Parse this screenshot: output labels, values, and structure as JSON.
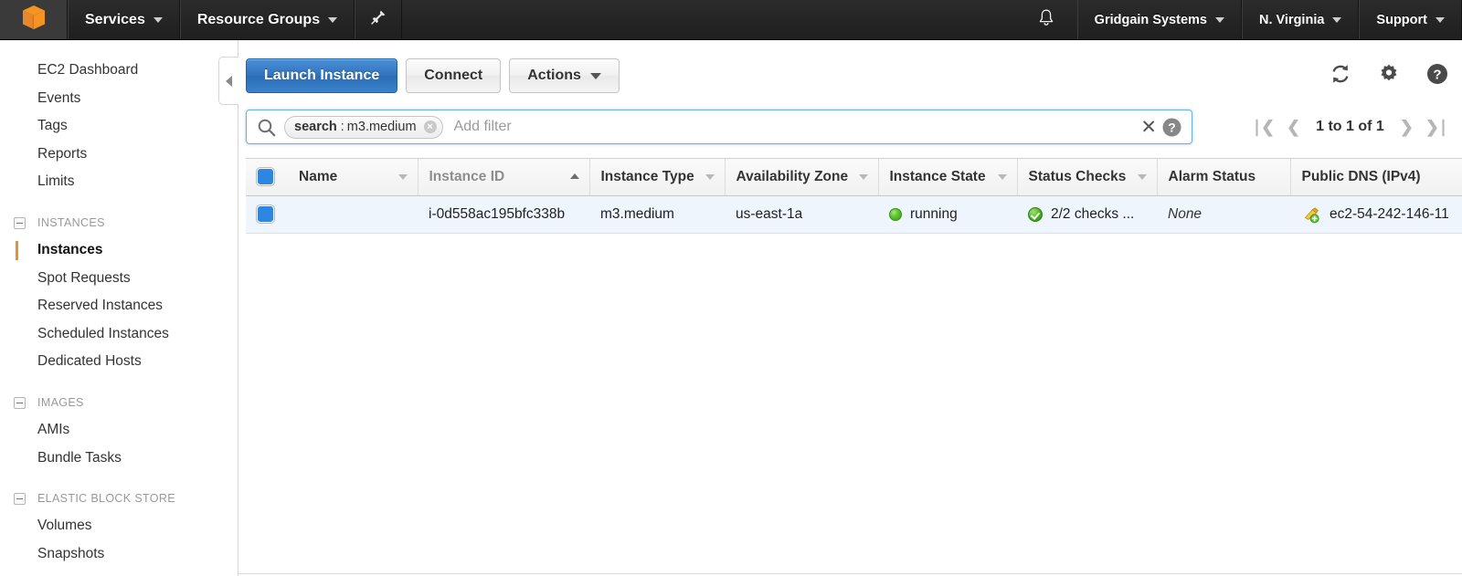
{
  "topnav": {
    "logo_icon": "aws-cube-logo",
    "services_label": "Services",
    "resource_groups_label": "Resource Groups",
    "pin_icon": "pin-icon",
    "bell_icon": "notifications-bell-icon",
    "account_label": "Gridgain Systems",
    "region_label": "N. Virginia",
    "support_label": "Support"
  },
  "sidebar": {
    "collapse_icon": "collapse-sidebar-arrow-icon",
    "items": [
      {
        "label": "EC2 Dashboard",
        "type": "link",
        "active": false
      },
      {
        "label": "Events",
        "type": "link",
        "active": false
      },
      {
        "label": "Tags",
        "type": "link",
        "active": false
      },
      {
        "label": "Reports",
        "type": "link",
        "active": false
      },
      {
        "label": "Limits",
        "type": "link",
        "active": false
      },
      {
        "label": "INSTANCES",
        "type": "group"
      },
      {
        "label": "Instances",
        "type": "link",
        "active": true
      },
      {
        "label": "Spot Requests",
        "type": "link",
        "active": false
      },
      {
        "label": "Reserved Instances",
        "type": "link",
        "active": false
      },
      {
        "label": "Scheduled Instances",
        "type": "link",
        "active": false
      },
      {
        "label": "Dedicated Hosts",
        "type": "link",
        "active": false
      },
      {
        "label": "IMAGES",
        "type": "group"
      },
      {
        "label": "AMIs",
        "type": "link",
        "active": false
      },
      {
        "label": "Bundle Tasks",
        "type": "link",
        "active": false
      },
      {
        "label": "ELASTIC BLOCK STORE",
        "type": "group"
      },
      {
        "label": "Volumes",
        "type": "link",
        "active": false
      },
      {
        "label": "Snapshots",
        "type": "link",
        "active": false
      }
    ]
  },
  "toolbar": {
    "launch_instance_label": "Launch Instance",
    "connect_label": "Connect",
    "actions_label": "Actions",
    "refresh_icon": "refresh-icon",
    "settings_icon": "gear-icon",
    "help_icon": "help-circle-icon"
  },
  "filterbar": {
    "search_icon": "search-icon",
    "token_key": "search",
    "token_separator": ":",
    "token_value": "m3.medium",
    "token_remove_icon": "remove-token-icon",
    "placeholder": "Add filter",
    "input_value": "",
    "clear_icon": "clear-all-filters-icon",
    "help_icon": "filter-help-icon",
    "pagination": {
      "first_icon": "first-page-icon",
      "prev_icon": "previous-page-icon",
      "range_label": "1 to 1 of 1",
      "next_icon": "next-page-icon",
      "last_icon": "last-page-icon"
    }
  },
  "table": {
    "select_all_checkbox": "select-all-checkbox",
    "columns": [
      {
        "label": "Name",
        "sort": "menu"
      },
      {
        "label": "Instance ID",
        "sort": "asc"
      },
      {
        "label": "Instance Type",
        "sort": "menu"
      },
      {
        "label": "Availability Zone",
        "sort": "menu"
      },
      {
        "label": "Instance State",
        "sort": "menu"
      },
      {
        "label": "Status Checks",
        "sort": "menu"
      },
      {
        "label": "Alarm Status",
        "sort": "none"
      },
      {
        "label": "Public DNS (IPv4)",
        "sort": "none"
      }
    ],
    "rows": [
      {
        "selected": true,
        "name": "",
        "instance_id": "i-0d558ac195bfc338b",
        "instance_type": "m3.medium",
        "availability_zone": "us-east-1a",
        "instance_state": "running",
        "instance_state_icon": "green-running-dot-icon",
        "status_checks": "2/2 checks ...",
        "status_checks_icon": "green-check-icon",
        "alarm_status": "None",
        "alarm_add_icon": "add-alarm-bell-icon",
        "public_dns": "ec2-54-242-146-11"
      }
    ]
  },
  "colors": {
    "aws_orange": "#ec912d",
    "primary_blue": "#2f73bd",
    "row_selected": "#eef5fd",
    "nav_dark": "#252525",
    "running_green": "#5cc22c"
  }
}
